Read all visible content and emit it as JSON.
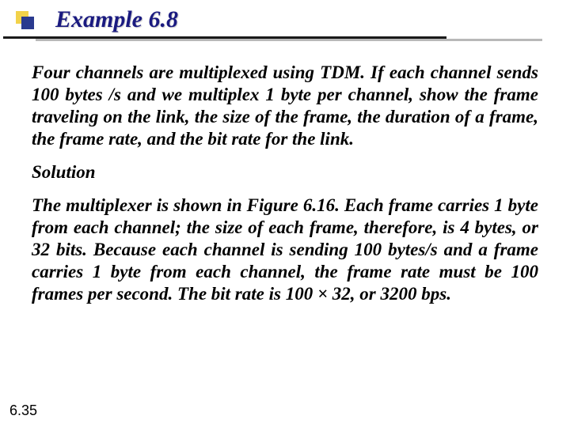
{
  "title": "Example 6.8",
  "problem": "Four channels are multiplexed using TDM. If each channel sends 100 bytes /s and we multiplex 1 byte per channel, show the frame traveling on the link, the size of the frame, the duration of a frame, the frame rate, and the bit rate for the link.",
  "solution_label": "Solution",
  "solution_body": "The multiplexer is shown in Figure 6.16. Each frame carries 1 byte from each channel; the size of each frame, therefore, is 4 bytes, or 32 bits. Because each channel is sending 100 bytes/s and a frame carries 1 byte from each channel, the frame rate must be 100 frames per second. The bit rate is 100 × 32, or 3200 bps.",
  "page_number": "6.35"
}
